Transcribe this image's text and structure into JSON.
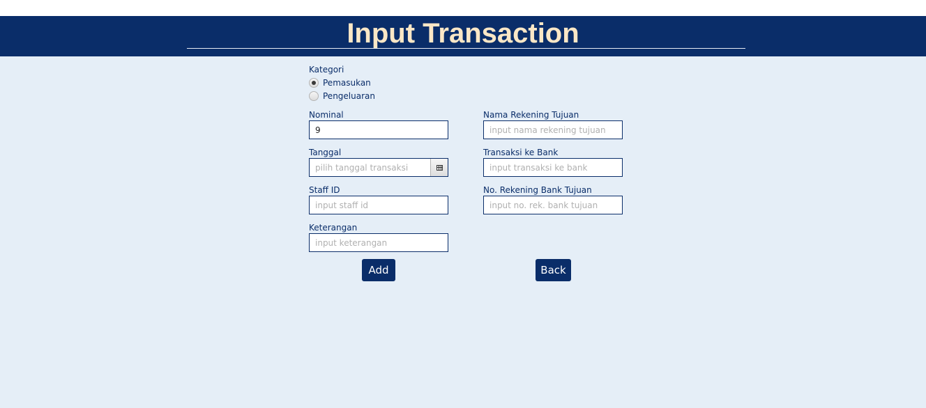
{
  "header": {
    "title": "Input Transaction"
  },
  "form": {
    "kategori": {
      "label": "Kategori",
      "options": [
        "Pemasukan",
        "Pengeluaran"
      ],
      "selected": "Pemasukan"
    },
    "nominal": {
      "label": "Nominal",
      "value": "9",
      "placeholder": ""
    },
    "tanggal": {
      "label": "Tanggal",
      "value": "",
      "placeholder": "pilih tanggal transaksi",
      "picker_icon": "calendar-icon"
    },
    "staff_id": {
      "label": "Staff ID",
      "value": "",
      "placeholder": "input staff id"
    },
    "keterangan": {
      "label": "Keterangan",
      "value": "",
      "placeholder": "input keterangan"
    },
    "nama_rekening": {
      "label": "Nama Rekening Tujuan",
      "value": "",
      "placeholder": "input nama rekening tujuan"
    },
    "transaksi_bank": {
      "label": "Transaksi ke Bank",
      "value": "",
      "placeholder": "input transaksi ke bank"
    },
    "no_rekening": {
      "label": "No. Rekening Bank Tujuan",
      "value": "",
      "placeholder": "input no. rek. bank tujuan"
    }
  },
  "buttons": {
    "add_label": "Add",
    "back_label": "Back"
  },
  "colors": {
    "primary": "#0a2d69",
    "title_text": "#fbe7c6",
    "background": "#e5eef7"
  }
}
